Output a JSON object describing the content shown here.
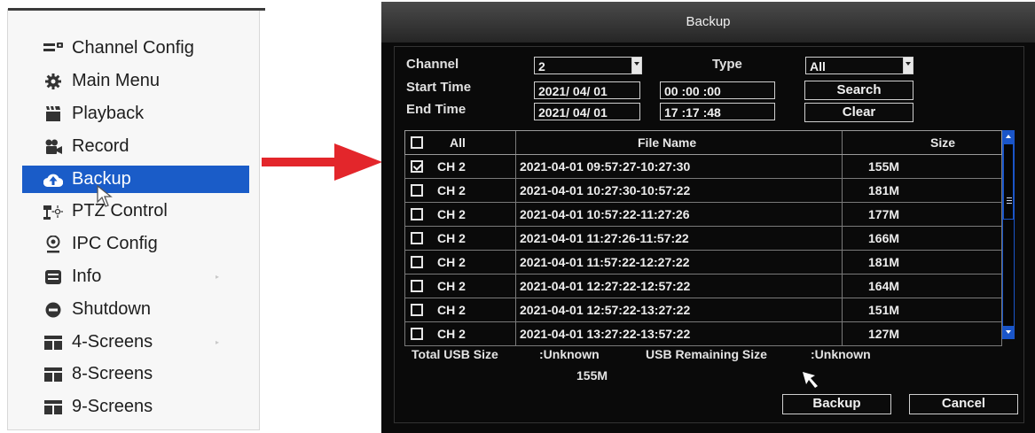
{
  "menu": {
    "items": [
      {
        "label": "Channel Config",
        "icon": "channel-config-icon"
      },
      {
        "label": "Main Menu",
        "icon": "gear-icon"
      },
      {
        "label": "Playback",
        "icon": "clapperboard-icon"
      },
      {
        "label": "Record",
        "icon": "camera-icon"
      },
      {
        "label": "Backup",
        "icon": "cloud-upload-icon",
        "active": true
      },
      {
        "label": "PTZ Control",
        "icon": "ptz-camera-icon"
      },
      {
        "label": "IPC Config",
        "icon": "location-pin-icon"
      },
      {
        "label": "Info",
        "icon": "info-list-icon"
      },
      {
        "label": "Shutdown",
        "icon": "minus-circle-icon"
      },
      {
        "label": "4-Screens",
        "icon": "screens-grid-icon"
      },
      {
        "label": "8-Screens",
        "icon": "screens-grid-icon"
      },
      {
        "label": "9-Screens",
        "icon": "screens-grid-icon"
      }
    ],
    "active_color": "#1a5cc8"
  },
  "dialog": {
    "title": "Backup",
    "channel_label": "Channel",
    "channel_value": "2",
    "type_label": "Type",
    "type_value": "All",
    "start_time_label": "Start Time",
    "start_date": "2021/ 04/ 01",
    "start_time": "00 :00 :00",
    "end_time_label": "End Time",
    "end_date": "2021/ 04/ 01",
    "end_time": "17 :17 :48",
    "search_label": "Search",
    "clear_label": "Clear",
    "table": {
      "headers": {
        "all": "All",
        "file_name": "File Name",
        "size": "Size"
      },
      "rows": [
        {
          "checked": true,
          "channel": "CH 2",
          "file": "2021-04-01 09:57:27-10:27:30",
          "size": "155M"
        },
        {
          "checked": false,
          "channel": "CH 2",
          "file": "2021-04-01 10:27:30-10:57:22",
          "size": "181M"
        },
        {
          "checked": false,
          "channel": "CH 2",
          "file": "2021-04-01 10:57:22-11:27:26",
          "size": "177M"
        },
        {
          "checked": false,
          "channel": "CH 2",
          "file": "2021-04-01 11:27:26-11:57:22",
          "size": "166M"
        },
        {
          "checked": false,
          "channel": "CH 2",
          "file": "2021-04-01 11:57:22-12:27:22",
          "size": "181M"
        },
        {
          "checked": false,
          "channel": "CH 2",
          "file": "2021-04-01 12:27:22-12:57:22",
          "size": "164M"
        },
        {
          "checked": false,
          "channel": "CH 2",
          "file": "2021-04-01 12:57:22-13:27:22",
          "size": "151M"
        },
        {
          "checked": false,
          "channel": "CH 2",
          "file": "2021-04-01 13:27:22-13:57:22",
          "size": "127M"
        }
      ]
    },
    "total_usb_label": "Total USB Size",
    "total_usb_value": ":Unknown",
    "usb_remaining_label": "USB Remaining Size",
    "usb_remaining_value": ":Unknown",
    "selected_size": "155M",
    "backup_button": "Backup",
    "cancel_button": "Cancel"
  }
}
